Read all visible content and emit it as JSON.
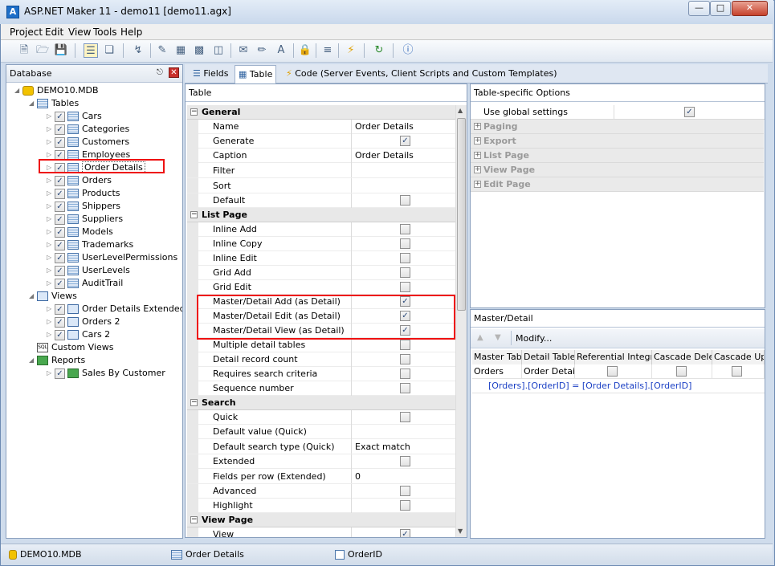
{
  "window": {
    "title": "ASP.NET Maker 11 - demo11 [demo11.agx]",
    "app_icon": "A"
  },
  "menu": [
    "Project",
    "Edit",
    "View",
    "Tools",
    "Help"
  ],
  "left_panel": {
    "title": "Database",
    "tree": {
      "root": "DEMO10.MDB",
      "tables_label": "Tables",
      "tables": [
        "Cars",
        "Categories",
        "Customers",
        "Employees",
        "Order Details",
        "Orders",
        "Products",
        "Shippers",
        "Suppliers",
        "Models",
        "Trademarks",
        "UserLevelPermissions",
        "UserLevels",
        "AuditTrail"
      ],
      "views_label": "Views",
      "views": [
        "Order Details Extended",
        "Orders 2",
        "Cars 2"
      ],
      "custom_views_label": "Custom Views",
      "reports_label": "Reports",
      "reports": [
        "Sales By Customer"
      ],
      "selected": "Order Details"
    }
  },
  "tabs": [
    "Fields",
    "Table",
    "Code (Server Events, Client Scripts and Custom Templates)"
  ],
  "table_grid": {
    "header": "Table",
    "sections": [
      {
        "title": "General",
        "rows": [
          {
            "name": "Name",
            "value": "Order Details"
          },
          {
            "name": "Generate",
            "check": true
          },
          {
            "name": "Caption",
            "value": "Order Details"
          },
          {
            "name": "Filter",
            "value": ""
          },
          {
            "name": "Sort",
            "value": ""
          },
          {
            "name": "Default",
            "check": false
          }
        ]
      },
      {
        "title": "List Page",
        "rows": [
          {
            "name": "Inline Add",
            "check": false
          },
          {
            "name": "Inline Copy",
            "check": false
          },
          {
            "name": "Inline Edit",
            "check": false
          },
          {
            "name": "Grid Add",
            "check": false
          },
          {
            "name": "Grid Edit",
            "check": false
          },
          {
            "name": "Master/Detail Add (as Detail)",
            "check": true
          },
          {
            "name": "Master/Detail Edit (as Detail)",
            "check": true
          },
          {
            "name": "Master/Detail View (as Detail)",
            "check": true
          },
          {
            "name": "Multiple detail tables",
            "check": false
          },
          {
            "name": "Detail record count",
            "check": false
          },
          {
            "name": "Requires search criteria",
            "check": false
          },
          {
            "name": "Sequence number",
            "check": false
          }
        ]
      },
      {
        "title": "Search",
        "rows": [
          {
            "name": "Quick",
            "check": false
          },
          {
            "name": "Default value (Quick)",
            "value": ""
          },
          {
            "name": "Default search type (Quick)",
            "value": "Exact match"
          },
          {
            "name": "Extended",
            "check": false
          },
          {
            "name": "Fields per row (Extended)",
            "value": "0"
          },
          {
            "name": "Advanced",
            "check": false
          },
          {
            "name": "Highlight",
            "check": false
          }
        ]
      },
      {
        "title": "View Page",
        "rows": [
          {
            "name": "View",
            "check": true
          }
        ]
      }
    ]
  },
  "table_options": {
    "header": "Table-specific Options",
    "use_global_label": "Use global settings",
    "use_global_checked": true,
    "groups": [
      "Paging",
      "Export",
      "List Page",
      "View Page",
      "Edit Page"
    ]
  },
  "master_detail": {
    "header": "Master/Detail",
    "modify_label": "Modify...",
    "columns": [
      "Master Table",
      "Detail Table",
      "Referential Integrity",
      "Cascade Delete",
      "Cascade Update"
    ],
    "row": {
      "master": "Orders",
      "detail": "Order Details"
    },
    "relation": "[Orders].[OrderID] = [Order Details].[OrderID]"
  },
  "status": [
    "DEMO10.MDB",
    "Order Details",
    "OrderID"
  ]
}
